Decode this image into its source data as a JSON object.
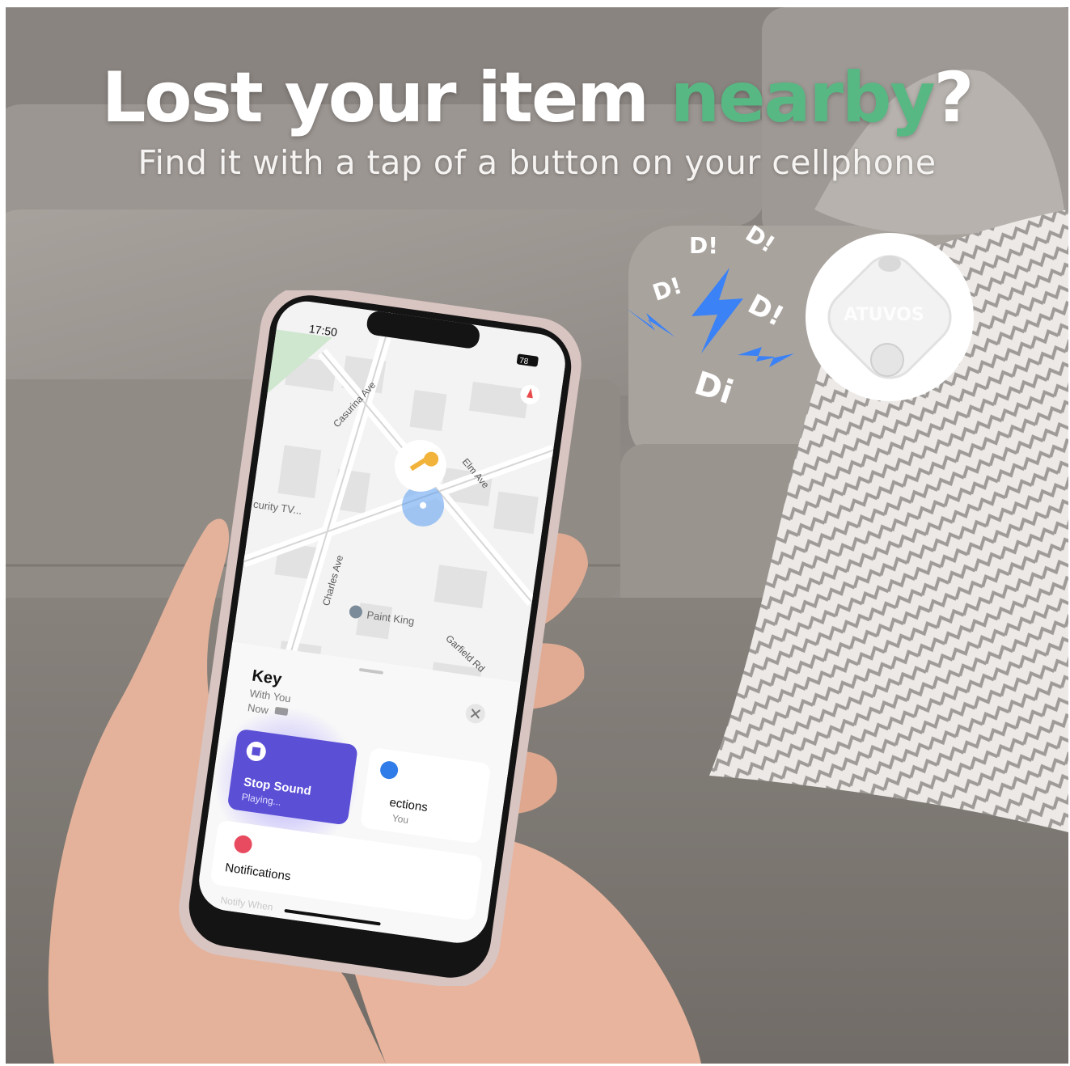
{
  "headline": {
    "part1": "Lost your item ",
    "accent": "nearby",
    "part2": "?"
  },
  "subline": "Find it with a tap of a button on your cellphone",
  "sound_effects": [
    "D!",
    "D!",
    "D!",
    "D!",
    "Di"
  ],
  "tracker": {
    "brand": "ATUVOS"
  },
  "phone": {
    "status": {
      "time": "17:50",
      "battery": "78"
    },
    "map": {
      "streets": [
        "Casurina Ave",
        "Elm Ave",
        "Charles Ave",
        "Garfield Rd"
      ],
      "places": [
        "curity TV...",
        "Paint King"
      ]
    },
    "sheet": {
      "title": "Key",
      "status": "With You",
      "time": "Now",
      "stop_sound_label": "Stop Sound",
      "stop_sound_status": "Playing...",
      "directions_label": "ections",
      "directions_status": "You",
      "notifications_label": "Notifications",
      "notify_when": "Notify When"
    }
  },
  "colors": {
    "accent": "#58b883",
    "bolt": "#3b82f6",
    "stop_button": "#5b4fd6",
    "pin": "#f1b33a"
  }
}
